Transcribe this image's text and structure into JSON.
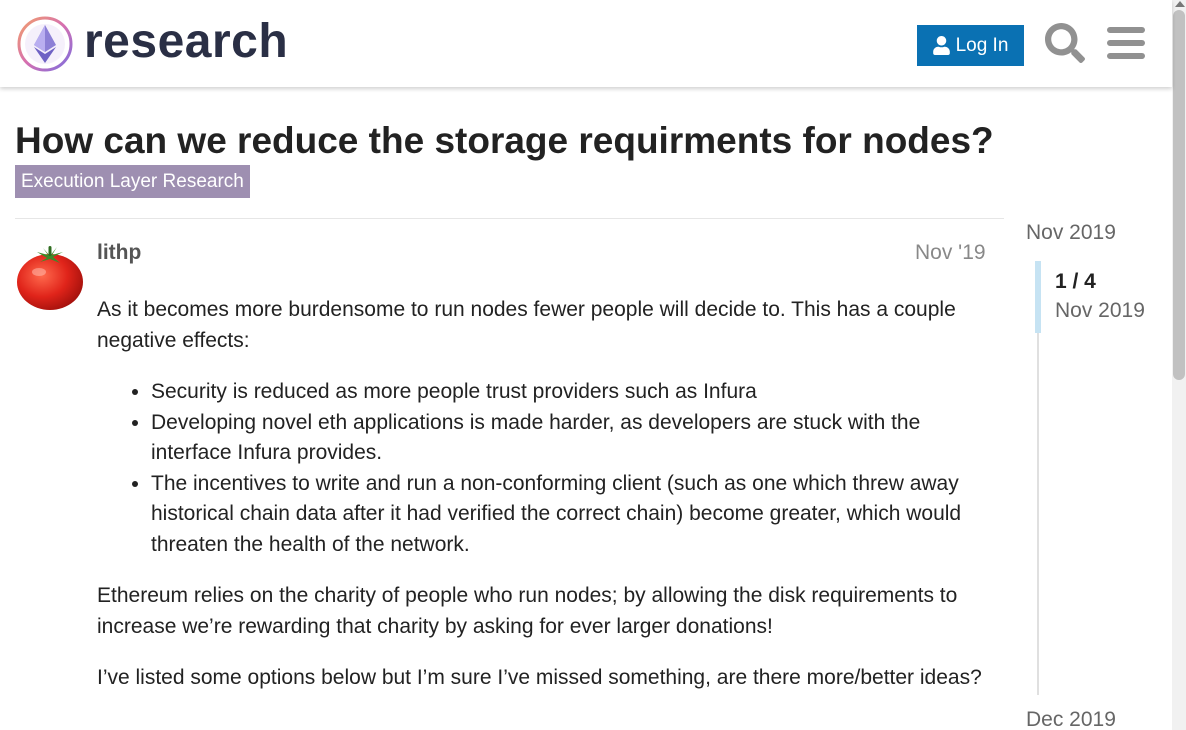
{
  "header": {
    "brand": "research",
    "login_label": "Log In"
  },
  "topic": {
    "title": "How can we reduce the storage requirments for nodes?",
    "category": "Execution Layer Research",
    "category_color": "#9e8fb1"
  },
  "post": {
    "username": "lithp",
    "date": "Nov '19",
    "paragraph_1": "As it becomes more burdensome to run nodes fewer people will decide to. This has a couple negative effects:",
    "bullets": [
      "Security is reduced as more people trust providers such as Infura",
      "Developing novel eth applications is made harder, as developers are stuck with the interface Infura provides.",
      "The incentives to write and run a non-conforming client (such as one which threw away historical chain data after it had verified the correct chain) become greater, which would threaten the health of the network."
    ],
    "paragraph_2": "Ethereum relies on the charity of people who run nodes; by allowing the disk requirements to increase we’re rewarding that charity by asking for ever larger donations!",
    "paragraph_3": "I’ve listed some options below but I’m sure I’ve missed something, are there more/better ideas?"
  },
  "timeline": {
    "start_date": "Nov 2019",
    "position": "1 / 4",
    "position_date": "Nov 2019",
    "end_date": "Dec 2019"
  },
  "icons": {
    "login": "user-icon",
    "search": "search-icon",
    "menu": "hamburger-menu-icon",
    "avatar": "tomato-avatar"
  },
  "colors": {
    "accent": "#0a71b3",
    "timeline_handle": "#c6e3f3"
  }
}
